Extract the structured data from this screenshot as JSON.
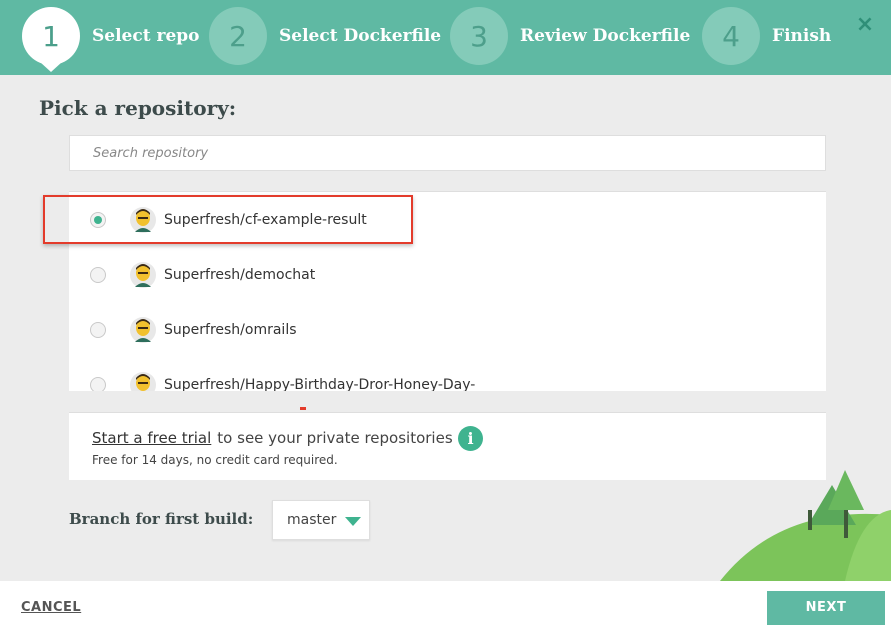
{
  "steps": [
    {
      "number": "1",
      "label": "Select repo",
      "active": true
    },
    {
      "number": "2",
      "label": "Select Dockerfile",
      "active": false
    },
    {
      "number": "3",
      "label": "Review Dockerfile",
      "active": false
    },
    {
      "number": "4",
      "label": "Finish",
      "active": false
    }
  ],
  "close_icon": "×",
  "heading": "Pick a repository:",
  "search": {
    "placeholder": "Search repository"
  },
  "repos": [
    {
      "name": "Superfresh/cf-example-result",
      "selected": true
    },
    {
      "name": "Superfresh/demochat",
      "selected": false
    },
    {
      "name": "Superfresh/omrails",
      "selected": false
    },
    {
      "name": "Superfresh/Happy-Birthday-Dror-Honey-Day-",
      "selected": false
    }
  ],
  "trial": {
    "link": "Start a free trial",
    "rest": "to see your private repositories",
    "subtext": "Free for 14 days, no credit card required.",
    "info_glyph": "i"
  },
  "branch": {
    "label": "Branch for first build:",
    "value": "master"
  },
  "footer": {
    "cancel": "CANCEL",
    "next": "NEXT"
  },
  "colors": {
    "accent": "#5fb9a3",
    "radio_selected": "#3fb38f",
    "highlight": "#e33b2b"
  }
}
